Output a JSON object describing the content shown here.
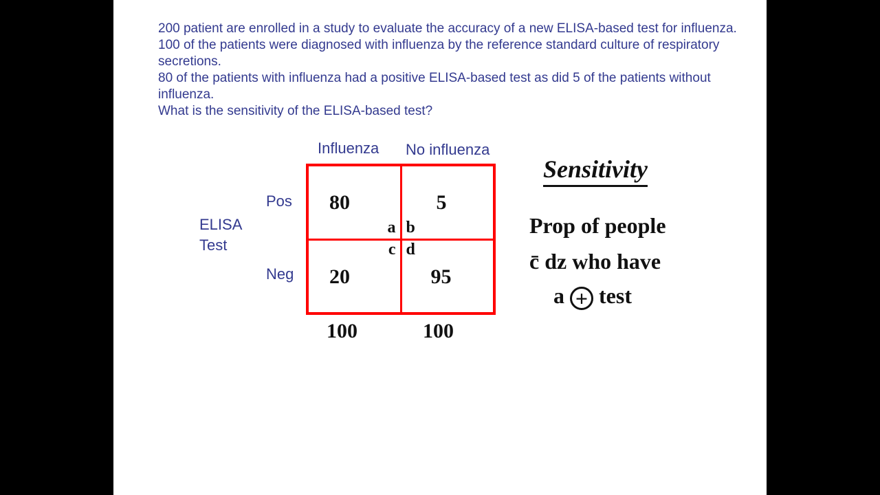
{
  "question": {
    "line1": "200 patient are enrolled in a study  to evaluate the accuracy of a new ELISA-based test for influenza.",
    "line2": "100 of the patients were diagnosed with influenza by the reference standard culture of respiratory secretions.",
    "line3": "80 of the patients with influenza had a positive ELISA-based test as did 5 of the patients without influenza.",
    "line4": "What is the sensitivity of the ELISA-based test?"
  },
  "labels": {
    "col1": "Influenza",
    "col2": "No influenza",
    "row_group": "ELISA\nTest",
    "row1": "Pos",
    "row2": "Neg"
  },
  "cells": {
    "a": "80",
    "b": "5",
    "c": "20",
    "d": "95",
    "a_letter": "a",
    "b_letter": "b",
    "c_letter": "c",
    "d_letter": "d",
    "col1_total": "100",
    "col2_total": "100"
  },
  "handwriting": {
    "title": "Sensitivity",
    "def1": "Prop of people",
    "def2_pre": "c̄ dz who have",
    "def3_pre": "a ",
    "def3_circ": "+",
    "def3_post": " test"
  }
}
